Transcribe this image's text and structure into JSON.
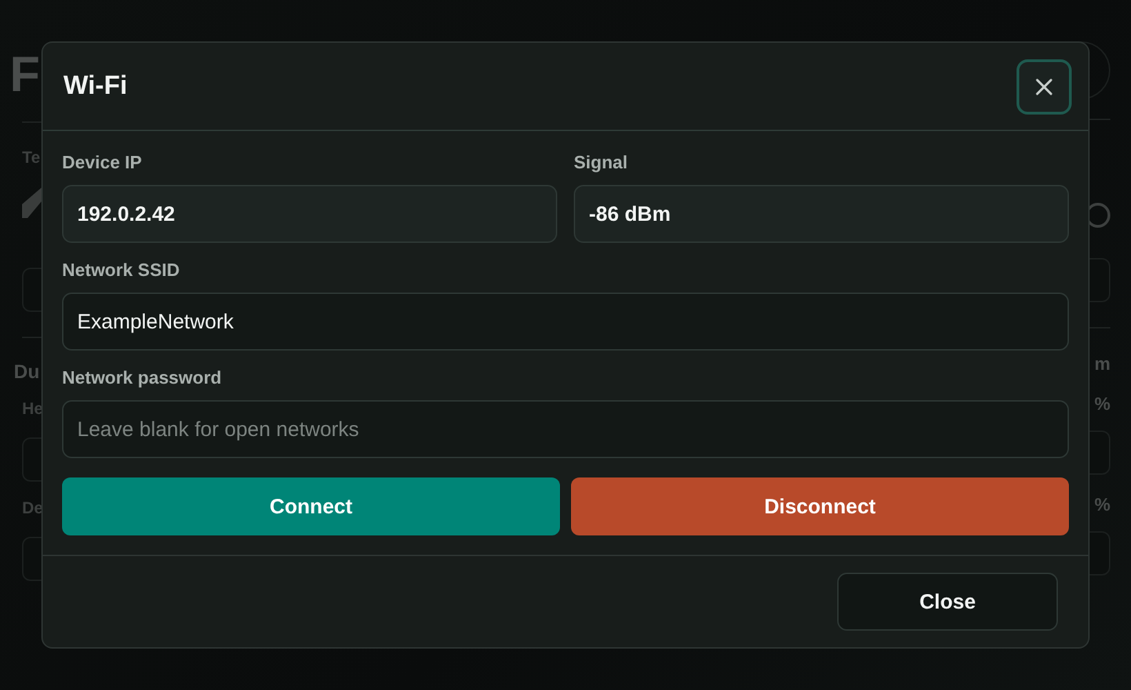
{
  "background": {
    "title": "F",
    "section_label": "Te",
    "section_heading": "Du",
    "labels": [
      "He",
      "De"
    ],
    "right_texts": [
      "m",
      "%",
      "%"
    ]
  },
  "dialog": {
    "title": "Wi-Fi",
    "rows": [
      {
        "fields": [
          {
            "label": "Device IP",
            "kind": "readout",
            "value": "192.0.2.42"
          },
          {
            "label": "Signal",
            "kind": "readout",
            "value": "-86 dBm"
          }
        ]
      },
      {
        "fields": [
          {
            "label": "Network SSID",
            "kind": "input",
            "value": "ExampleNetwork"
          }
        ]
      },
      {
        "fields": [
          {
            "label": "Network password",
            "kind": "input",
            "placeholder": "Leave blank for open networks"
          }
        ]
      }
    ],
    "actions": [
      {
        "label": "Connect",
        "kind": "primary"
      },
      {
        "label": "Disconnect",
        "kind": "danger"
      }
    ],
    "footer_button": "Close"
  }
}
